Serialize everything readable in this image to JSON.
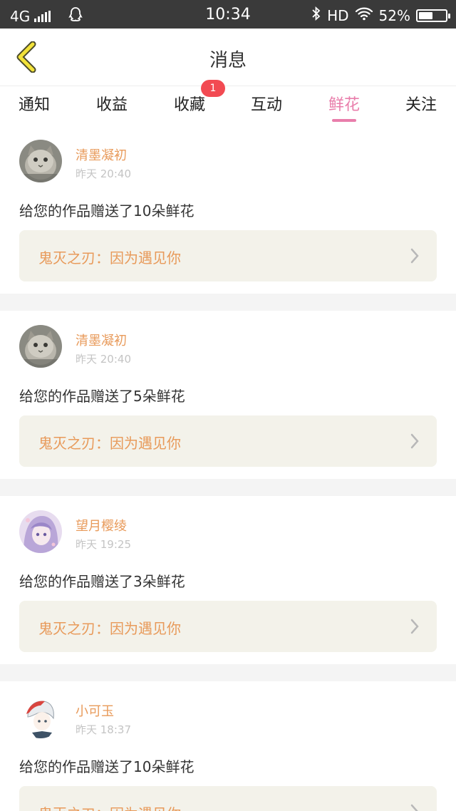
{
  "status_bar": {
    "network": "4G",
    "time": "10:34",
    "hd": "HD",
    "battery_percent": "52%",
    "battery_level": 0.52
  },
  "header": {
    "title": "消息"
  },
  "tabs": [
    {
      "label": "通知"
    },
    {
      "label": "收益"
    },
    {
      "label": "收藏",
      "badge": "1"
    },
    {
      "label": "互动"
    },
    {
      "label": "鲜花",
      "active": true
    },
    {
      "label": "关注"
    }
  ],
  "messages": [
    {
      "user": "清墨凝初",
      "time": "昨天 20:40",
      "text": "给您的作品赠送了10朵鲜花",
      "work": "鬼灭之刃：因为遇见你"
    },
    {
      "user": "清墨凝初",
      "time": "昨天 20:40",
      "text": "给您的作品赠送了5朵鲜花",
      "work": "鬼灭之刃：因为遇见你"
    },
    {
      "user": "望月樱绫",
      "time": "昨天 19:25",
      "text": "给您的作品赠送了3朵鲜花",
      "work": "鬼灭之刃：因为遇见你"
    },
    {
      "user": "小可玉",
      "time": "昨天 18:37",
      "text": "给您的作品赠送了10朵鲜花",
      "work": "鬼灭之刃：因为遇见你"
    }
  ],
  "colors": {
    "accent_pink": "#e97eab",
    "username_orange": "#e89a5a",
    "badge_red": "#f24a52",
    "back_icon_yellow": "#f2e23a"
  }
}
